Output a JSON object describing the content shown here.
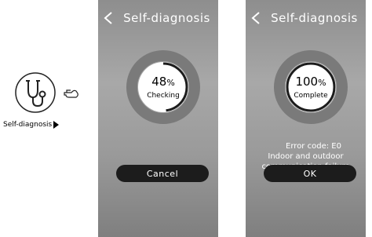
{
  "illustration": {
    "label": "Self-diagnosis"
  },
  "screens": [
    {
      "title": "Self-diagnosis",
      "percent": "48",
      "percent_unit": "%",
      "progress": 0.48,
      "status": "Checking",
      "button_label": "Cancel"
    },
    {
      "title": "Self-diagnosis",
      "percent": "100",
      "percent_unit": "%",
      "progress": 1.0,
      "status": "Complete",
      "error_code": "Error code:  E0",
      "error_line1": "Indoor and outdoor",
      "error_line2": "communication failure",
      "button_label": "OK"
    }
  ],
  "colors": {
    "panel": "#9a9a9a",
    "ring_track": "#777777",
    "ring_progress": "#1c1c1c",
    "button": "#1c1c1c"
  },
  "icons": {
    "stethoscope": "stethoscope-icon",
    "hand": "pointing-hand-icon",
    "back": "chevron-left-icon",
    "play": "play-triangle-icon"
  }
}
